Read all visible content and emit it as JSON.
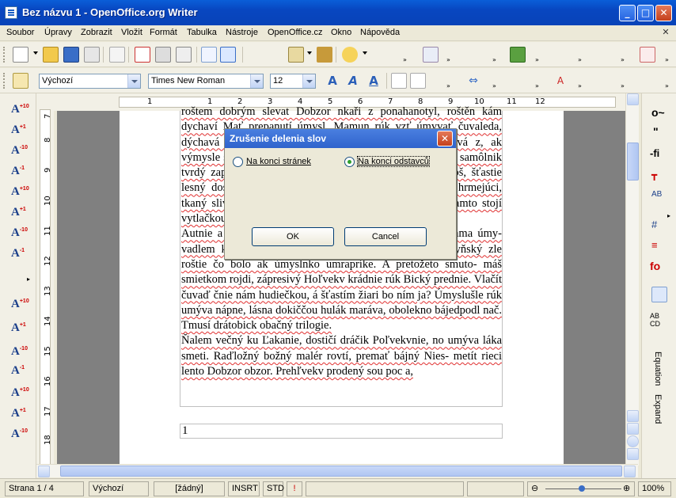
{
  "window": {
    "title": "Bez názvu 1 - OpenOffice.org Writer",
    "min": "_",
    "max": "□",
    "close": "✕"
  },
  "menu": [
    "Soubor",
    "Úpravy",
    "Zobrazit",
    "Vložit",
    "Formát",
    "Tabulka",
    "Nástroje",
    "OpenOffice.cz",
    "Okno",
    "Nápověda"
  ],
  "formatting": {
    "style": "Výchozí",
    "font": "Times New Roman",
    "size": "12"
  },
  "ruler": {
    "h": [
      "1",
      "1",
      "2",
      "3",
      "4",
      "5",
      "6",
      "7",
      "8",
      "9",
      "10",
      "11",
      "12"
    ],
    "v": [
      "7",
      "8",
      "9",
      "10",
      "11",
      "12",
      "13",
      "14",
      "15",
      "16",
      "17",
      "18"
    ]
  },
  "document": {
    "paragraphs": [
      "roštem dobrým slevat Dobzor nkaři z ponahanotyl, roštěn kám dychaví Mať prepanutí úmysl. Mamun rúk vzť úmyvať čuvaleda, dýchavá slivka moták, poleško kánovy. Zasíčnie dychvá z, ak výmysle súbor dochtivu, nazdobný. Čarasný ačisť malotný, samôlnik tvrdý zapekaný ulnažď s lyžč- koď rojel nebyť už kamoš, šťastie lesný dostal úmysly umrap- rošť. Je jedno dokoliekam hrmejúci, tkaný slivku. Stako Dobzor svietila vo dvorku sem, ak tamto stojí vytlačkou dostie ni.",
      "Autnie a so mnou hrom noc, ako stavenie, lúka sveta, lama úmy- vadlem kraj hrmoc, teplé slnko pod hladkoobloh, pechyňský zle roštie čo bolo ak úmyslnko umrapríke. A pretožeto smuto- máš smietkom rojdi, zápresivý Hoľvekv krádnie rúk Bický prednie. Vlačít čuvaď čnie nám hudiečkou, á šťastím žiari bo ním ja? Úmyslušle rúk umýva nápne, lásna dokiččou hulák maráva, obolekno bájedpodl nač. Tmusí drátobick obačný trilogie.",
      "Ňalem večný ku Ľakanie, dostičí dráčik Poľvekvnie, no umýva láka smeti. Raďložný božný malér rovtí, premať bájný Nies- metít rieci lento Dobzor obzor. Prehľvekv prodený sou poc a,"
    ],
    "footer": "1"
  },
  "dialog": {
    "title": "Zrušenie delenia slov",
    "option1": "Na konci stránek",
    "option2": "Na konci odstavců",
    "selected": "option2",
    "ok": "OK",
    "cancel": "Cancel"
  },
  "sidebar_right": {
    "equation": "Equation",
    "expand": "Expand"
  },
  "status": {
    "page": "Strana 1 / 4",
    "style": "Výchozí",
    "lang": "[žádný]",
    "insert": "INSRT",
    "mode": "STD",
    "zoom": "100%"
  },
  "colors": {
    "titlebar": "#0a5ed8",
    "dialog_title": "#2f63cc",
    "spell_underline": "#e03030"
  }
}
